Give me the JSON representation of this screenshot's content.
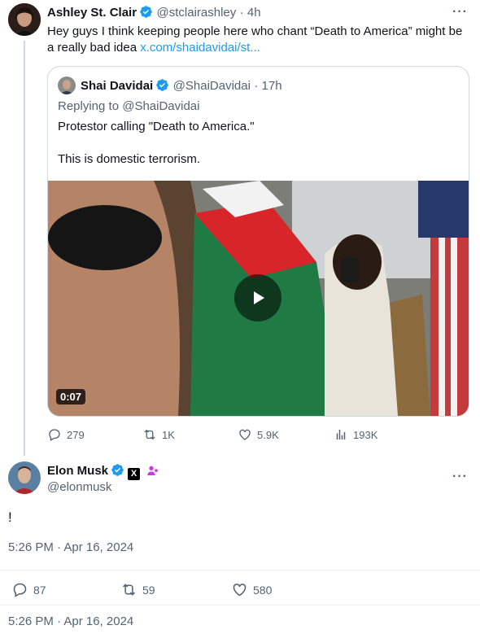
{
  "tweet1": {
    "name": "Ashley St. Clair",
    "handle": "@stclairashley",
    "time": "· 4h",
    "text": "Hey guys I think keeping people here who chant “Death to America” might be a really bad idea ",
    "link": "x.com/shaidavidai/st..."
  },
  "quote": {
    "name": "Shai Davidai",
    "handle": "@ShaiDavidai",
    "time": "· 17h",
    "replying_to": "Replying to @ShaiDavidai",
    "text1": "Protestor calling \"Death to America.\"",
    "text2": "This is domestic terrorism.",
    "video_duration": "0:07"
  },
  "tweet1_stats": {
    "replies": "279",
    "reposts": "1K",
    "likes": "5.9K",
    "views": "193K"
  },
  "main_tweet": {
    "name": "Elon Musk",
    "handle": "@elonmusk",
    "badge_x": "X",
    "text": "!",
    "timestamp": "5:26 PM · Apr 16, 2024"
  },
  "main_stats": {
    "replies": "87",
    "reposts": "59",
    "likes": "580"
  },
  "footer": {
    "timestamp": "5:26 PM · Apr 16, 2024"
  },
  "colors": {
    "verified": "#1d9bf0",
    "link": "#1d9bf0",
    "secondary": "#536471",
    "border": "#cfd9de"
  }
}
